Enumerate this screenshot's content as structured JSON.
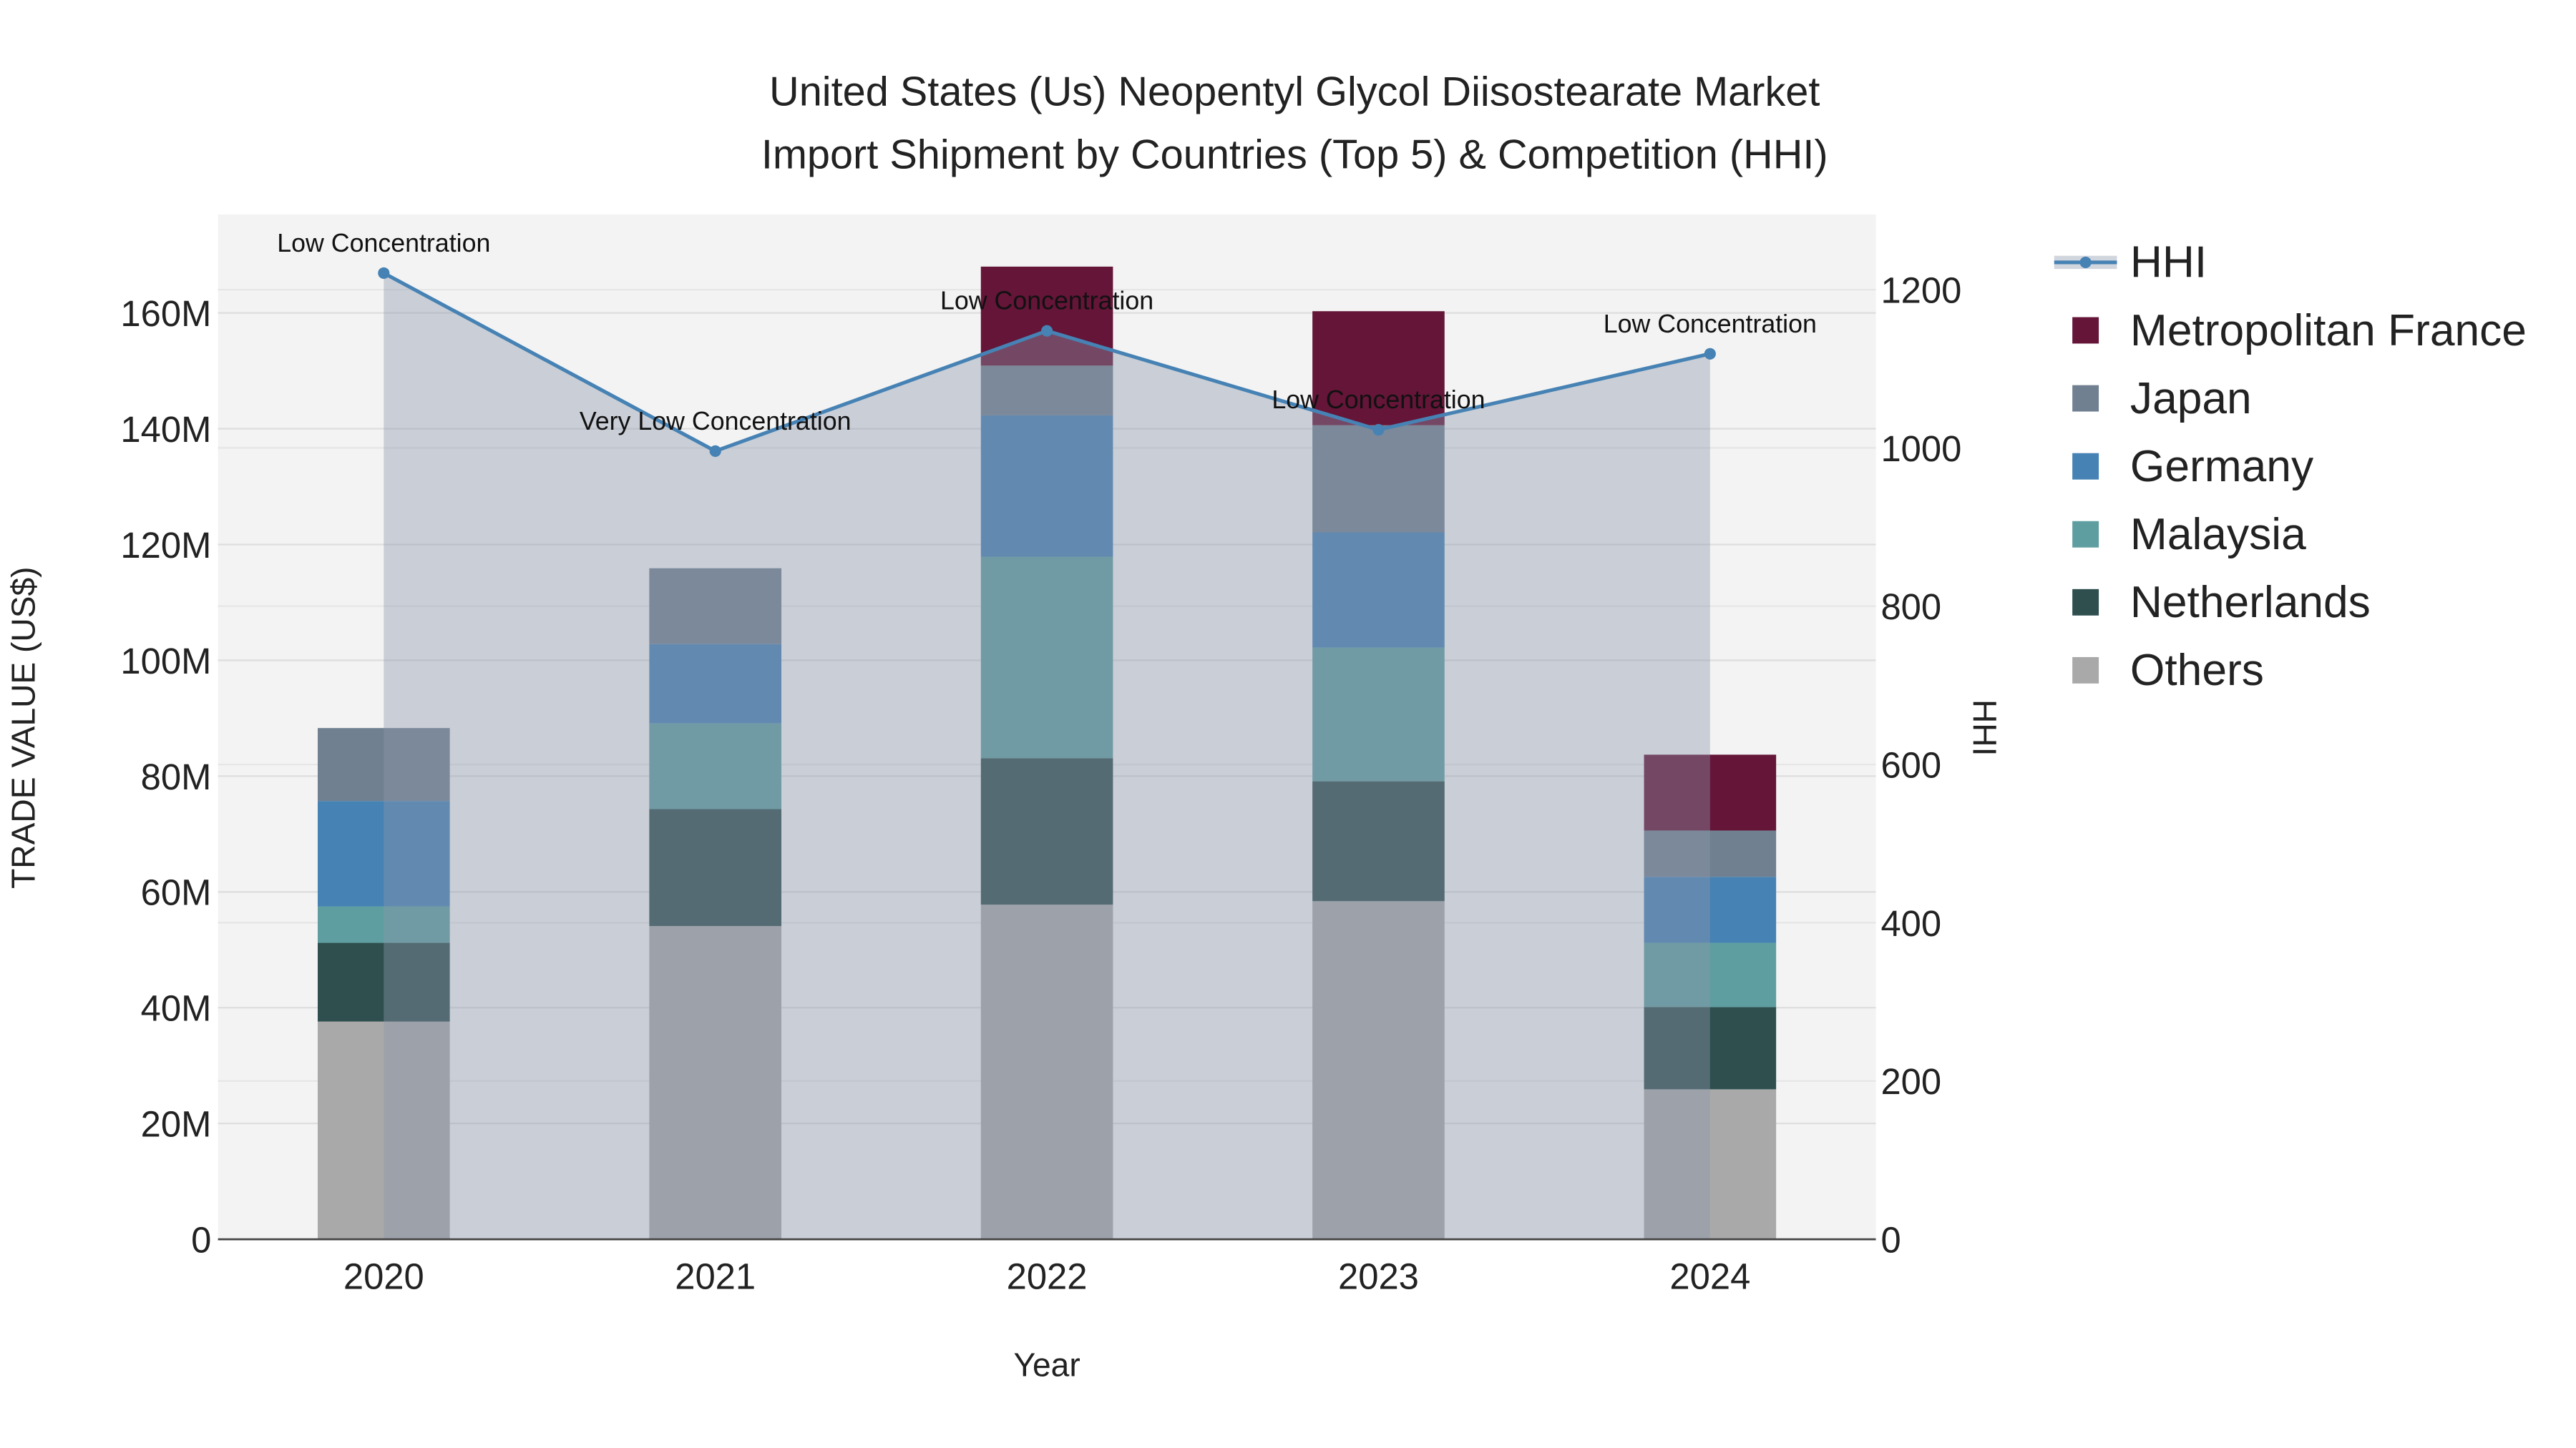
{
  "chart_data": {
    "type": "bar",
    "stacked": true,
    "title_lines": [
      "United States (Us) Neopentyl Glycol Diisostearate Market",
      "Import Shipment by Countries (Top 5) & Competition (HHI)"
    ],
    "xlabel": "Year",
    "ylabel": "TRADE VALUE (US$)",
    "y2label": "HHI",
    "categories": [
      "2020",
      "2021",
      "2022",
      "2023",
      "2024"
    ],
    "ylim": [
      0,
      177000000
    ],
    "y_ticks": [
      0,
      20000000,
      40000000,
      60000000,
      80000000,
      100000000,
      120000000,
      140000000,
      160000000
    ],
    "y_tick_labels": [
      "0",
      "20M",
      "40M",
      "60M",
      "80M",
      "100M",
      "120M",
      "140M",
      "160M"
    ],
    "y2lim": [
      0,
      1295
    ],
    "y2_ticks": [
      0,
      200,
      400,
      600,
      800,
      1000,
      1200
    ],
    "y2_tick_labels": [
      "0",
      "200",
      "400",
      "600",
      "800",
      "1000",
      "1200"
    ],
    "series": [
      {
        "name": "Others",
        "color": "#A9A9A9",
        "values": [
          37600000,
          54100000,
          57800000,
          58400000,
          25900000
        ]
      },
      {
        "name": "Netherlands",
        "color": "#2F4F4F",
        "values": [
          13600000,
          20200000,
          25300000,
          20700000,
          14200000
        ]
      },
      {
        "name": "Malaysia",
        "color": "#5F9EA0",
        "values": [
          6300000,
          14800000,
          34800000,
          23100000,
          11100000
        ]
      },
      {
        "name": "Germany",
        "color": "#4682B4",
        "values": [
          18200000,
          13700000,
          24400000,
          19900000,
          11400000
        ]
      },
      {
        "name": "Japan",
        "color": "#708090",
        "values": [
          12600000,
          13100000,
          8600000,
          18500000,
          8000000
        ]
      },
      {
        "name": "Metropolitan France",
        "color": "#641538",
        "values": [
          0,
          0,
          17100000,
          19700000,
          13100000
        ]
      }
    ],
    "hhi": {
      "name": "HHI",
      "color": "#4682B4",
      "values": [
        1221,
        996,
        1148,
        1023,
        1119
      ],
      "annotations": [
        "Low Concentration",
        "Very Low Concentration",
        "Low Concentration",
        "Low Concentration",
        "Low Concentration"
      ]
    },
    "legend_order": [
      "HHI",
      "Metropolitan France",
      "Japan",
      "Germany",
      "Malaysia",
      "Netherlands",
      "Others"
    ],
    "legend_placement": "right",
    "grid": true
  }
}
